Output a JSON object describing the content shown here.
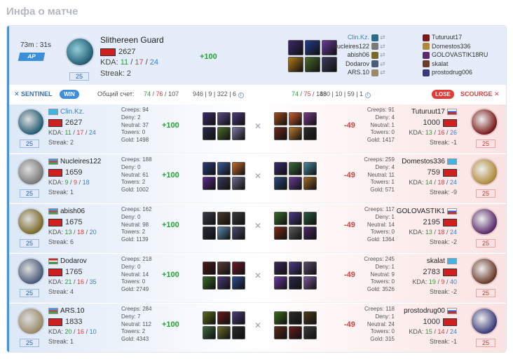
{
  "page": {
    "title": "Инфа о матче"
  },
  "summary": {
    "time": "73m : 31s",
    "mode": "AP",
    "player_name": "Slithereen Guard",
    "mmr": "2627",
    "kda_label": "KDA:",
    "kills": "11",
    "deaths": "17",
    "assists": "24",
    "streak": "Streak: 2",
    "level": "25",
    "points": "+100",
    "avatar_color": "#245c74",
    "item_colors": [
      "#3a2a6a",
      "#243c8a",
      "#6a3a9a",
      "#b07a1a",
      "#4a6a2a",
      "#3a3a5a"
    ],
    "left_players": [
      "Clin.Kz.",
      "Nucleires122",
      "abish06",
      "Dodarov",
      "ARS.10"
    ],
    "right_players": [
      "Tuturuut17",
      "Domestos336",
      "GOLOVASTIK18RU",
      "skalat",
      "prostodrug006"
    ],
    "left_avatar_colors": [
      "#2a6a8a",
      "#7a7a7a",
      "#7a6a2a",
      "#4a5a7a",
      "#9a8a6a"
    ],
    "right_avatar_colors": [
      "#7a1a1a",
      "#b08a3a",
      "#5a2a6a",
      "#6a3a2a",
      "#3a3a7a"
    ]
  },
  "divider": {
    "sentinel": "SENTINEL",
    "win": "WIN",
    "total_label": "Общий счет:",
    "left_k": "74",
    "left_d": "76",
    "left_a": "107",
    "left_extra": "946 | 9 | 322 | 6",
    "right_k": "74",
    "right_d": "75",
    "right_a": "146",
    "right_extra": "830 | 10 | 59 | 1",
    "lose": "LOSE",
    "scourge": "SCOURGE"
  },
  "rows": [
    {
      "left": {
        "name": "Clin.Kz.",
        "flag": "kz",
        "mmr": "2627",
        "kills": "11",
        "deaths": "17",
        "assists": "24",
        "streak": "Streak: 2",
        "level": "25",
        "creeps": "Creeps: 94",
        "deny": "Deny: 2",
        "neutral": "Neutral: 37",
        "towers": "Towers: 0",
        "gold": "Gold: 1498",
        "points": "+100",
        "avatar": "#245c74",
        "items": [
          "#3a2a6a",
          "#5a4a8a",
          "#4a3a7a",
          "#2a2a4a",
          "#4a6a2a",
          "#7a7aa0"
        ]
      },
      "right": {
        "name": "Tuturuut17",
        "flag": "ru",
        "mmr": "1000",
        "kills": "13",
        "deaths": "16",
        "assists": "26",
        "streak": "Streak: -1",
        "level": "25",
        "creeps": "Creeps: 91",
        "deny": "Deny: 4",
        "neutral": "Neutral: 1",
        "towers": "Towers: 0",
        "gold": "Gold: 1417",
        "points": "-49",
        "avatar": "#7a1a1a",
        "items": [
          "#a04a1a",
          "#d05a2a",
          "#7a3a8a",
          "#6a2a1a",
          "#c07a2a",
          "#2a2a2a"
        ]
      }
    },
    {
      "left": {
        "name": "Nucleires122",
        "flag": "az",
        "mmr": "1659",
        "kills": "9",
        "deaths": "9",
        "assists": "18",
        "streak": "Streak: 1",
        "level": "25",
        "creeps": "Creeps: 188",
        "deny": "Deny: 0",
        "neutral": "Neutral: 61",
        "towers": "Towers: 2",
        "gold": "Gold: 1002",
        "points": "+100",
        "avatar": "#7a7a7a",
        "items": [
          "#2a3a7a",
          "#3a5a9a",
          "#c06a2a",
          "#5a2a8a",
          "#3a3a5a",
          "#6a6a8a"
        ]
      },
      "right": {
        "name": "Domestos336",
        "flag": "kz",
        "mmr": "759",
        "kills": "14",
        "deaths": "18",
        "assists": "24",
        "streak": "Streak: -9",
        "level": "25",
        "creeps": "Creeps: 259",
        "deny": "Deny: 4",
        "neutral": "Neutral: 11",
        "towers": "Towers: 1",
        "gold": "Gold: 571",
        "points": "-49",
        "avatar": "#b08a3a",
        "items": [
          "#3a2a6a",
          "#3a6a3a",
          "#4a8aa0",
          "#2a4a7a",
          "#6a3a9a",
          "#a06a2a"
        ]
      }
    },
    {
      "left": {
        "name": "abish06",
        "flag": "az",
        "mmr": "1675",
        "kills": "13",
        "deaths": "18",
        "assists": "20",
        "streak": "Streak: 6",
        "level": "25",
        "creeps": "Creeps: 162",
        "deny": "Deny: 0",
        "neutral": "Neutral: 98",
        "towers": "Towers: 2",
        "gold": "Gold: 1139",
        "points": "+100",
        "avatar": "#7a6a2a",
        "items": [
          "#3a3a4a",
          "#4a3a2a",
          "#3a3a3a",
          "#2a2a3a",
          "#5a8ab0",
          "#4a4a6a"
        ]
      },
      "right": {
        "name": "GOLOVASTIK1",
        "flag": "ru",
        "mmr": "2195",
        "kills": "13",
        "deaths": "18",
        "assists": "24",
        "streak": "Streak: -2",
        "level": "25",
        "creeps": "Creeps: 117",
        "deny": "Deny: 1",
        "neutral": "Neutral: 14",
        "towers": "Towers: 0",
        "gold": "Gold: 1364",
        "points": "-49",
        "avatar": "#5a2a6a",
        "items": [
          "#3a6a2a",
          "#4a3a8a",
          "#2a5a3a",
          "#7a2a1a",
          "#5a5a5a",
          "#4a2a6a"
        ]
      }
    },
    {
      "left": {
        "name": "Dodarov",
        "flag": "tj",
        "mmr": "1765",
        "kills": "21",
        "deaths": "16",
        "assists": "35",
        "streak": "Streak: 4",
        "level": "25",
        "creeps": "Creeps: 218",
        "deny": "Deny: 0",
        "neutral": "Neutral: 14",
        "towers": "Towers: 0",
        "gold": "Gold: 2749",
        "points": "+100",
        "avatar": "#4a5a7a",
        "items": [
          "#4a1a1a",
          "#5a3a3a",
          "#6a1a2a",
          "#3a6a2a",
          "#4a3a7a",
          "#2a4a8a"
        ]
      },
      "right": {
        "name": "skalat",
        "flag": "kz",
        "mmr": "2783",
        "kills": "19",
        "deaths": "9",
        "assists": "40",
        "streak": "Streak: -2",
        "level": "25",
        "creeps": "Creeps: 245",
        "deny": "Deny: 1",
        "neutral": "Neutral: 9",
        "towers": "Towers: 0",
        "gold": "Gold: 3526",
        "points": "-49",
        "avatar": "#6a3a2a",
        "items": [
          "#3a2a5a",
          "#4a3a8a",
          "#5a4a6a",
          "#6a3aa0",
          "#2a2a4a",
          "#7a5a9a"
        ]
      }
    },
    {
      "left": {
        "name": "ARS.10",
        "flag": "az",
        "mmr": "1833",
        "kills": "20",
        "deaths": "16",
        "assists": "10",
        "streak": "Streak: 1",
        "level": "25",
        "creeps": "Creeps: 284",
        "deny": "Deny: 7",
        "neutral": "Neutral: 112",
        "towers": "Towers: 2",
        "gold": "Gold: 4343",
        "points": "+100",
        "avatar": "#9a8a6a",
        "items": [
          "#5a6a1a",
          "#6a1a1a",
          "#4a3a7a",
          "#3a6a3a",
          "#6a6a2a",
          "#2a2a2a"
        ]
      },
      "right": {
        "name": "prostodrug00",
        "flag": "ru",
        "mmr": "1000",
        "kills": "15",
        "deaths": "14",
        "assists": "24",
        "streak": "Streak: -1",
        "level": "25",
        "creeps": "Creeps: 118",
        "deny": "Deny: 1",
        "neutral": "Neutral: 24",
        "towers": "Towers: 0",
        "gold": "Gold: 315",
        "points": "-49",
        "avatar": "#3a3a7a",
        "items": [
          "#3a6a1a",
          "#2a2a2a",
          "#4a3a1a",
          "#5a2a1a",
          "#6a1a1a",
          "#3a3a3a"
        ]
      }
    }
  ]
}
